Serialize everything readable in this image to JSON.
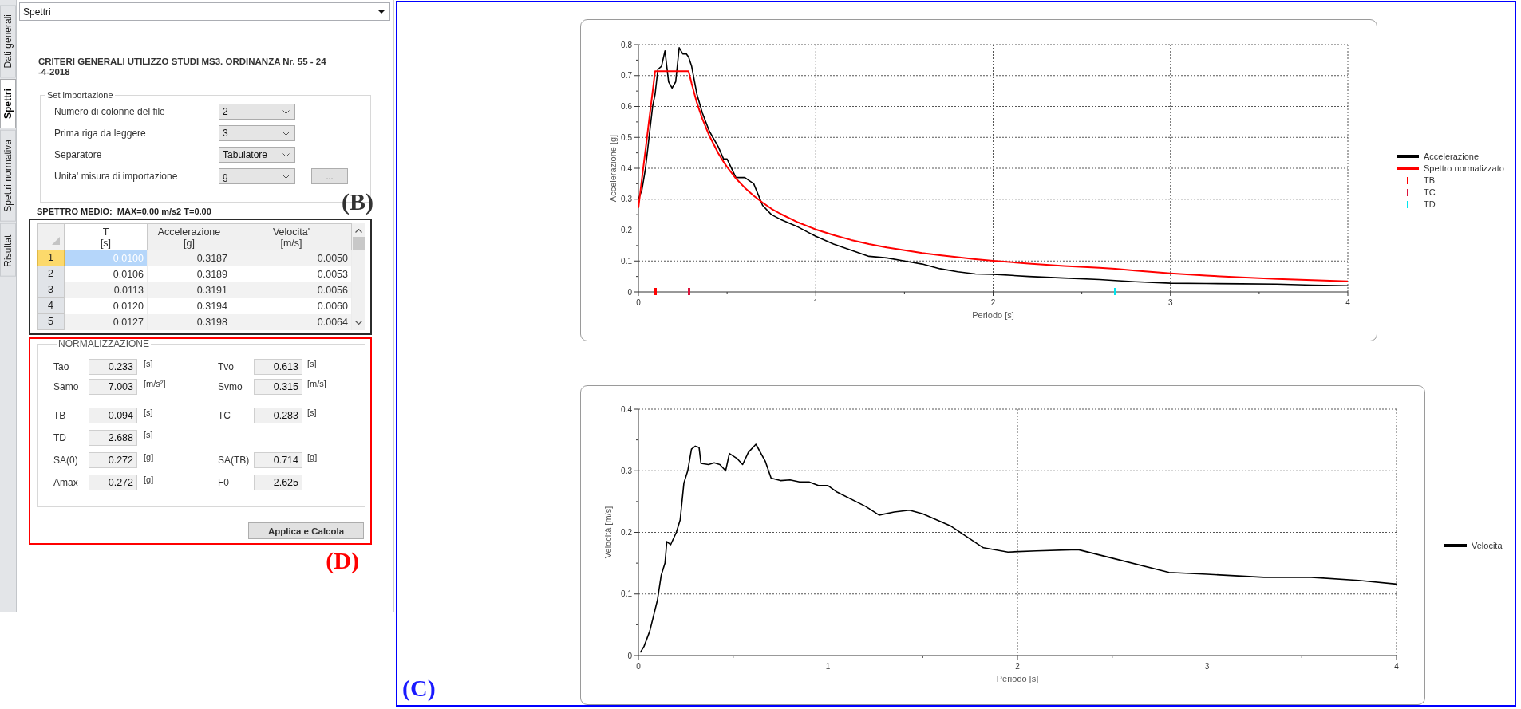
{
  "tabs": [
    {
      "label": "Dati generali",
      "selected": false
    },
    {
      "label": "Spettri",
      "selected": true
    },
    {
      "label": "Spettri normativa",
      "selected": false
    },
    {
      "label": "Risultati",
      "selected": false
    }
  ],
  "view_selector": {
    "value": "Spettri"
  },
  "title": {
    "lines": [
      "CRITERI GENERALI UTILIZZO STUDI MS3. ORDINANZA Nr. 55 - 24",
      "-4-2018"
    ]
  },
  "import_settings": {
    "title": "Set importazione",
    "callout": "(B)",
    "rows": [
      {
        "label": "Numero di colonne del file",
        "value": "2"
      },
      {
        "label": "Prima riga da leggere",
        "value": "3"
      },
      {
        "label": "Separatore",
        "value": "Tabulatore"
      },
      {
        "label": "Unita' misura di importazione",
        "value": "g",
        "button": "..."
      }
    ]
  },
  "summary": "SPETTRO MEDIO:  MAX=0.00 m/s2 T=0.00",
  "table": {
    "columns": [
      {
        "label": "T",
        "unit": "[s]",
        "selected": true
      },
      {
        "label": "Accelerazione",
        "unit": "[g]",
        "selected": false
      },
      {
        "label": "Velocita'",
        "unit": "[m/s]",
        "selected": false
      }
    ],
    "rows": [
      {
        "index": "1",
        "selected": true,
        "cells": [
          "0.0100",
          "0.3187",
          "0.0050"
        ]
      },
      {
        "index": "2",
        "selected": false,
        "cells": [
          "0.0106",
          "0.3189",
          "0.0053"
        ]
      },
      {
        "index": "3",
        "selected": false,
        "cells": [
          "0.0113",
          "0.3191",
          "0.0056"
        ]
      },
      {
        "index": "4",
        "selected": false,
        "cells": [
          "0.0120",
          "0.3194",
          "0.0060"
        ]
      },
      {
        "index": "5",
        "selected": false,
        "cells": [
          "0.0127",
          "0.3198",
          "0.0064"
        ]
      }
    ]
  },
  "normalization": {
    "title": "NORMALIZZAZIONE",
    "callout": "(D)",
    "groups": [
      [
        {
          "fields": [
            {
              "label": "Tao",
              "value": "0.233",
              "unit": "[s]"
            },
            {
              "label": "Tvo",
              "value": "0.613",
              "unit": "[s]"
            }
          ]
        },
        {
          "fields": [
            {
              "label": "Samo",
              "value": "7.003",
              "unit": "[m/s²]"
            },
            {
              "label": "Svmo",
              "value": "0.315",
              "unit": "[m/s]"
            }
          ]
        }
      ],
      [
        {
          "fields": [
            {
              "label": "TB",
              "value": "0.094",
              "unit": "[s]"
            },
            {
              "label": "TC",
              "value": "0.283",
              "unit": "[s]"
            }
          ]
        },
        {
          "fields": [
            {
              "label": "TD",
              "value": "2.688",
              "unit": "[s]"
            }
          ]
        },
        {
          "fields": [
            {
              "label": "SA(0)",
              "value": "0.272",
              "unit": "[g]"
            },
            {
              "label": "SA(TB)",
              "value": "0.714",
              "unit": "[g]"
            }
          ]
        },
        {
          "fields": [
            {
              "label": "Amax",
              "value": "0.272",
              "unit": "[g]"
            },
            {
              "label": "F0",
              "value": "2.625"
            }
          ]
        }
      ]
    ],
    "button": "Applica e Calcola"
  },
  "charts": {
    "callout": "(C)",
    "items": [
      {
        "chart_data": {
          "type": "line",
          "grid": true,
          "xlabel": "Periodo [s]",
          "ylabel": "Accelerazione [g]",
          "xlim": [
            0,
            4
          ],
          "ylim": [
            0,
            0.8
          ],
          "xticks": [
            0,
            1,
            2,
            3,
            4
          ],
          "yticks": [
            0,
            0.1,
            0.2,
            0.3,
            0.4,
            0.5,
            0.6,
            0.7,
            0.8
          ],
          "x": [
            0,
            0.02,
            0.04,
            0.06,
            0.08,
            0.094,
            0.11,
            0.13,
            0.15,
            0.17,
            0.19,
            0.21,
            0.23,
            0.25,
            0.27,
            0.283,
            0.3,
            0.33,
            0.36,
            0.4,
            0.45,
            0.48,
            0.5,
            0.55,
            0.6,
            0.65,
            0.7,
            0.75,
            0.8,
            0.9,
            1,
            1.1,
            1.2,
            1.3,
            1.4,
            1.5,
            1.6,
            1.7,
            1.8,
            1.9,
            2,
            2.2,
            2.4,
            2.6,
            2.688,
            2.8,
            3,
            3.2,
            3.4,
            3.6,
            3.8,
            4
          ],
          "series": [
            {
              "name": "Accelerazione",
              "color": "#000000",
              "values": [
                0.3,
                0.33,
                0.4,
                0.5,
                0.6,
                0.64,
                0.72,
                0.73,
                0.78,
                0.68,
                0.66,
                0.68,
                0.79,
                0.77,
                0.77,
                0.76,
                0.73,
                0.64,
                0.58,
                0.52,
                0.47,
                0.43,
                0.43,
                0.37,
                0.37,
                0.35,
                0.28,
                0.25,
                0.235,
                0.21,
                0.18,
                0.155,
                0.135,
                0.115,
                0.11,
                0.1,
                0.09,
                0.075,
                0.065,
                0.058,
                0.057,
                0.05,
                0.045,
                0.04,
                0.037,
                0.033,
                0.028,
                0.027,
                0.026,
                0.025,
                0.022,
                0.02
              ]
            },
            {
              "name": "Spettro normalizzato",
              "color": "#ff0000",
              "values": [
                0.272,
                0.366,
                0.46,
                0.554,
                0.648,
                0.714,
                0.714,
                0.714,
                0.714,
                0.714,
                0.714,
                0.714,
                0.714,
                0.714,
                0.714,
                0.714,
                0.674,
                0.612,
                0.561,
                0.505,
                0.449,
                0.421,
                0.404,
                0.367,
                0.337,
                0.311,
                0.289,
                0.269,
                0.253,
                0.225,
                0.202,
                0.184,
                0.168,
                0.155,
                0.144,
                0.135,
                0.126,
                0.119,
                0.112,
                0.106,
                0.101,
                0.092,
                0.084,
                0.078,
                0.075,
                0.069,
                0.06,
                0.053,
                0.047,
                0.042,
                0.038,
                0.034
              ]
            },
            {
              "name": "TB",
              "color": "#ff0000",
              "marker": "square",
              "values": [
                null,
                null,
                null,
                null,
                null,
                0,
                null,
                null,
                null,
                null,
                null,
                null,
                null,
                null,
                null,
                null,
                null,
                null,
                null,
                null,
                null,
                null,
                null,
                null,
                null,
                null,
                null,
                null,
                null,
                null,
                null,
                null,
                null,
                null,
                null,
                null,
                null,
                null,
                null,
                null,
                null,
                null,
                null,
                null,
                null,
                null,
                null,
                null,
                null,
                null,
                null,
                null
              ]
            },
            {
              "name": "TC",
              "color": "#dc143c",
              "marker": "square",
              "values": [
                null,
                null,
                null,
                null,
                null,
                null,
                null,
                null,
                null,
                null,
                null,
                null,
                null,
                null,
                null,
                0,
                null,
                null,
                null,
                null,
                null,
                null,
                null,
                null,
                null,
                null,
                null,
                null,
                null,
                null,
                null,
                null,
                null,
                null,
                null,
                null,
                null,
                null,
                null,
                null,
                null,
                null,
                null,
                null,
                null,
                null,
                null,
                null,
                null,
                null,
                null,
                null
              ]
            },
            {
              "name": "TD",
              "color": "#00e5ee",
              "marker": "square",
              "values": [
                null,
                null,
                null,
                null,
                null,
                null,
                null,
                null,
                null,
                null,
                null,
                null,
                null,
                null,
                null,
                null,
                null,
                null,
                null,
                null,
                null,
                null,
                null,
                null,
                null,
                null,
                null,
                null,
                null,
                null,
                null,
                null,
                null,
                null,
                null,
                null,
                null,
                null,
                null,
                null,
                null,
                null,
                null,
                null,
                0,
                null,
                null,
                null,
                null,
                null,
                null,
                null
              ]
            }
          ]
        }
      },
      {
        "chart_data": {
          "type": "line",
          "grid": true,
          "xlabel": "Periodo [s]",
          "ylabel": "Velocità [m/s]",
          "xlim": [
            0,
            4
          ],
          "ylim": [
            0,
            0.4
          ],
          "xticks": [
            0,
            1,
            2,
            3,
            4
          ],
          "yticks": [
            0,
            0.1,
            0.2,
            0.3,
            0.4
          ],
          "x": [
            0.01,
            0.03,
            0.06,
            0.1,
            0.12,
            0.14,
            0.15,
            0.17,
            0.2,
            0.22,
            0.24,
            0.26,
            0.28,
            0.3,
            0.32,
            0.33,
            0.37,
            0.4,
            0.43,
            0.46,
            0.48,
            0.52,
            0.55,
            0.58,
            0.62,
            0.67,
            0.7,
            0.75,
            0.8,
            0.85,
            0.9,
            0.95,
            1,
            1.05,
            1.2,
            1.27,
            1.35,
            1.43,
            1.5,
            1.65,
            1.82,
            1.95,
            2.1,
            2.32,
            2.5,
            2.8,
            3,
            3.3,
            3.55,
            3.8,
            4
          ],
          "series": [
            {
              "name": "Velocita'",
              "color": "#000000",
              "values": [
                0.005,
                0.015,
                0.04,
                0.09,
                0.13,
                0.15,
                0.185,
                0.18,
                0.2,
                0.22,
                0.28,
                0.3,
                0.335,
                0.34,
                0.338,
                0.312,
                0.31,
                0.313,
                0.31,
                0.3,
                0.328,
                0.32,
                0.31,
                0.33,
                0.343,
                0.315,
                0.288,
                0.284,
                0.285,
                0.282,
                0.282,
                0.276,
                0.276,
                0.265,
                0.242,
                0.228,
                0.233,
                0.236,
                0.23,
                0.21,
                0.175,
                0.168,
                0.17,
                0.172,
                0.158,
                0.135,
                0.132,
                0.127,
                0.127,
                0.122,
                0.116
              ]
            }
          ]
        }
      }
    ]
  }
}
